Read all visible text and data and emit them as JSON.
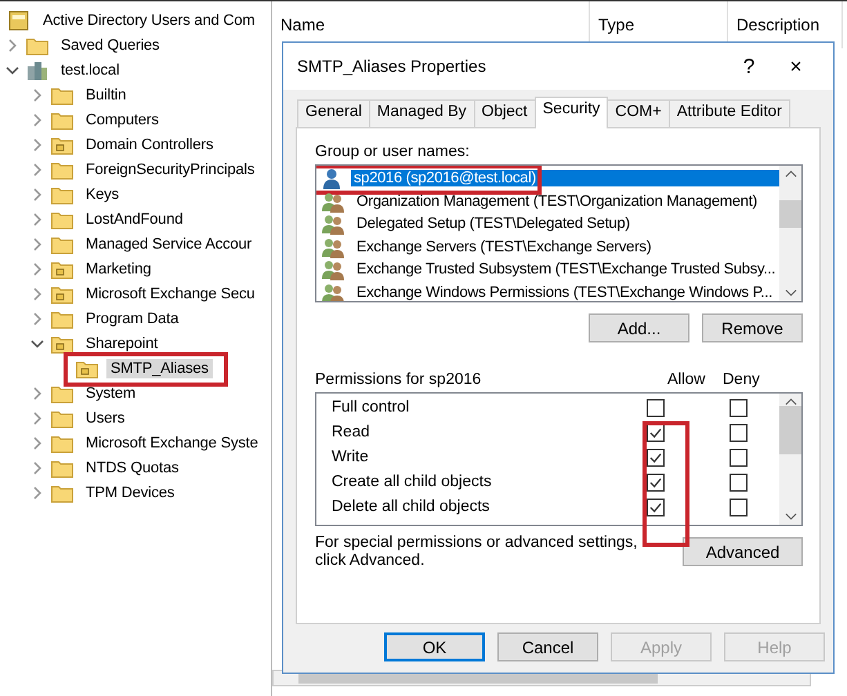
{
  "tree": [
    {
      "label": "Active Directory Users and Com",
      "kind": "console",
      "children": [
        {
          "label": "Saved Queries",
          "kind": "folder",
          "expanded": false
        },
        {
          "label": "test.local",
          "kind": "domain",
          "expanded": true,
          "children": [
            {
              "label": "Builtin",
              "kind": "folder",
              "expanded": false
            },
            {
              "label": "Computers",
              "kind": "folder",
              "expanded": false
            },
            {
              "label": "Domain Controllers",
              "kind": "ou",
              "expanded": false
            },
            {
              "label": "ForeignSecurityPrincipals",
              "kind": "folder",
              "expanded": false
            },
            {
              "label": "Keys",
              "kind": "folder",
              "expanded": false
            },
            {
              "label": "LostAndFound",
              "kind": "folder",
              "expanded": false
            },
            {
              "label": "Managed Service Accour",
              "kind": "folder",
              "expanded": false
            },
            {
              "label": "Marketing",
              "kind": "ou",
              "expanded": false
            },
            {
              "label": "Microsoft Exchange Secu",
              "kind": "ou",
              "expanded": false
            },
            {
              "label": "Program Data",
              "kind": "folder",
              "expanded": false
            },
            {
              "label": "Sharepoint",
              "kind": "ou",
              "expanded": true,
              "children": [
                {
                  "label": "SMTP_Aliases",
                  "kind": "ou",
                  "selected": true,
                  "highlighted": true
                }
              ]
            },
            {
              "label": "System",
              "kind": "folder",
              "expanded": false
            },
            {
              "label": "Users",
              "kind": "folder",
              "expanded": false
            },
            {
              "label": "Microsoft Exchange Syste",
              "kind": "folder",
              "expanded": false
            },
            {
              "label": "NTDS Quotas",
              "kind": "folder",
              "expanded": false
            },
            {
              "label": "TPM Devices",
              "kind": "folder",
              "expanded": false
            }
          ]
        }
      ]
    }
  ],
  "columns": [
    "Name",
    "Type",
    "Description"
  ],
  "dialog": {
    "title": "SMTP_Aliases Properties",
    "help": "?",
    "close": "×",
    "tabs": [
      {
        "label": "General",
        "selected": false
      },
      {
        "label": "Managed By",
        "selected": false
      },
      {
        "label": "Object",
        "selected": false
      },
      {
        "label": "Security",
        "selected": true
      },
      {
        "label": "COM+",
        "selected": false
      },
      {
        "label": "Attribute Editor",
        "selected": false
      }
    ],
    "group_label": "Group or user names:",
    "principals": [
      {
        "name": "sp2016 (sp2016@test.local)",
        "kind": "user",
        "selected": true,
        "highlighted": true
      },
      {
        "name": "Organization Management (TEST\\Organization Management)",
        "kind": "group",
        "selected": false,
        "highlighted": false
      },
      {
        "name": "Delegated Setup (TEST\\Delegated Setup)",
        "kind": "group",
        "selected": false,
        "highlighted": false
      },
      {
        "name": "Exchange Servers (TEST\\Exchange Servers)",
        "kind": "group",
        "selected": false,
        "highlighted": false
      },
      {
        "name": "Exchange Trusted Subsystem (TEST\\Exchange Trusted Subsy...",
        "kind": "group",
        "selected": false,
        "highlighted": false
      },
      {
        "name": "Exchange Windows Permissions (TEST\\Exchange Windows P...",
        "kind": "group",
        "selected": false,
        "highlighted": false
      }
    ],
    "principal_buttons": [
      "Add...",
      "Remove"
    ],
    "permissions_label": "Permissions for sp2016",
    "allow_header": "Allow",
    "deny_header": "Deny",
    "allow_column_highlighted": true,
    "permissions": [
      {
        "name": "Full control",
        "allow": false,
        "deny": false
      },
      {
        "name": "Read",
        "allow": true,
        "deny": false
      },
      {
        "name": "Write",
        "allow": true,
        "deny": false
      },
      {
        "name": "Create all child objects",
        "allow": true,
        "deny": false
      },
      {
        "name": "Delete all child objects",
        "allow": true,
        "deny": false
      }
    ],
    "advanced_note": "For special permissions or advanced settings, click Advanced.",
    "advanced_button": "Advanced",
    "buttons": [
      {
        "label": "OK",
        "kind": "default",
        "disabled": false
      },
      {
        "label": "Cancel",
        "kind": "normal",
        "disabled": false
      },
      {
        "label": "Apply",
        "kind": "normal",
        "disabled": true
      },
      {
        "label": "Help",
        "kind": "normal",
        "disabled": true
      }
    ]
  }
}
